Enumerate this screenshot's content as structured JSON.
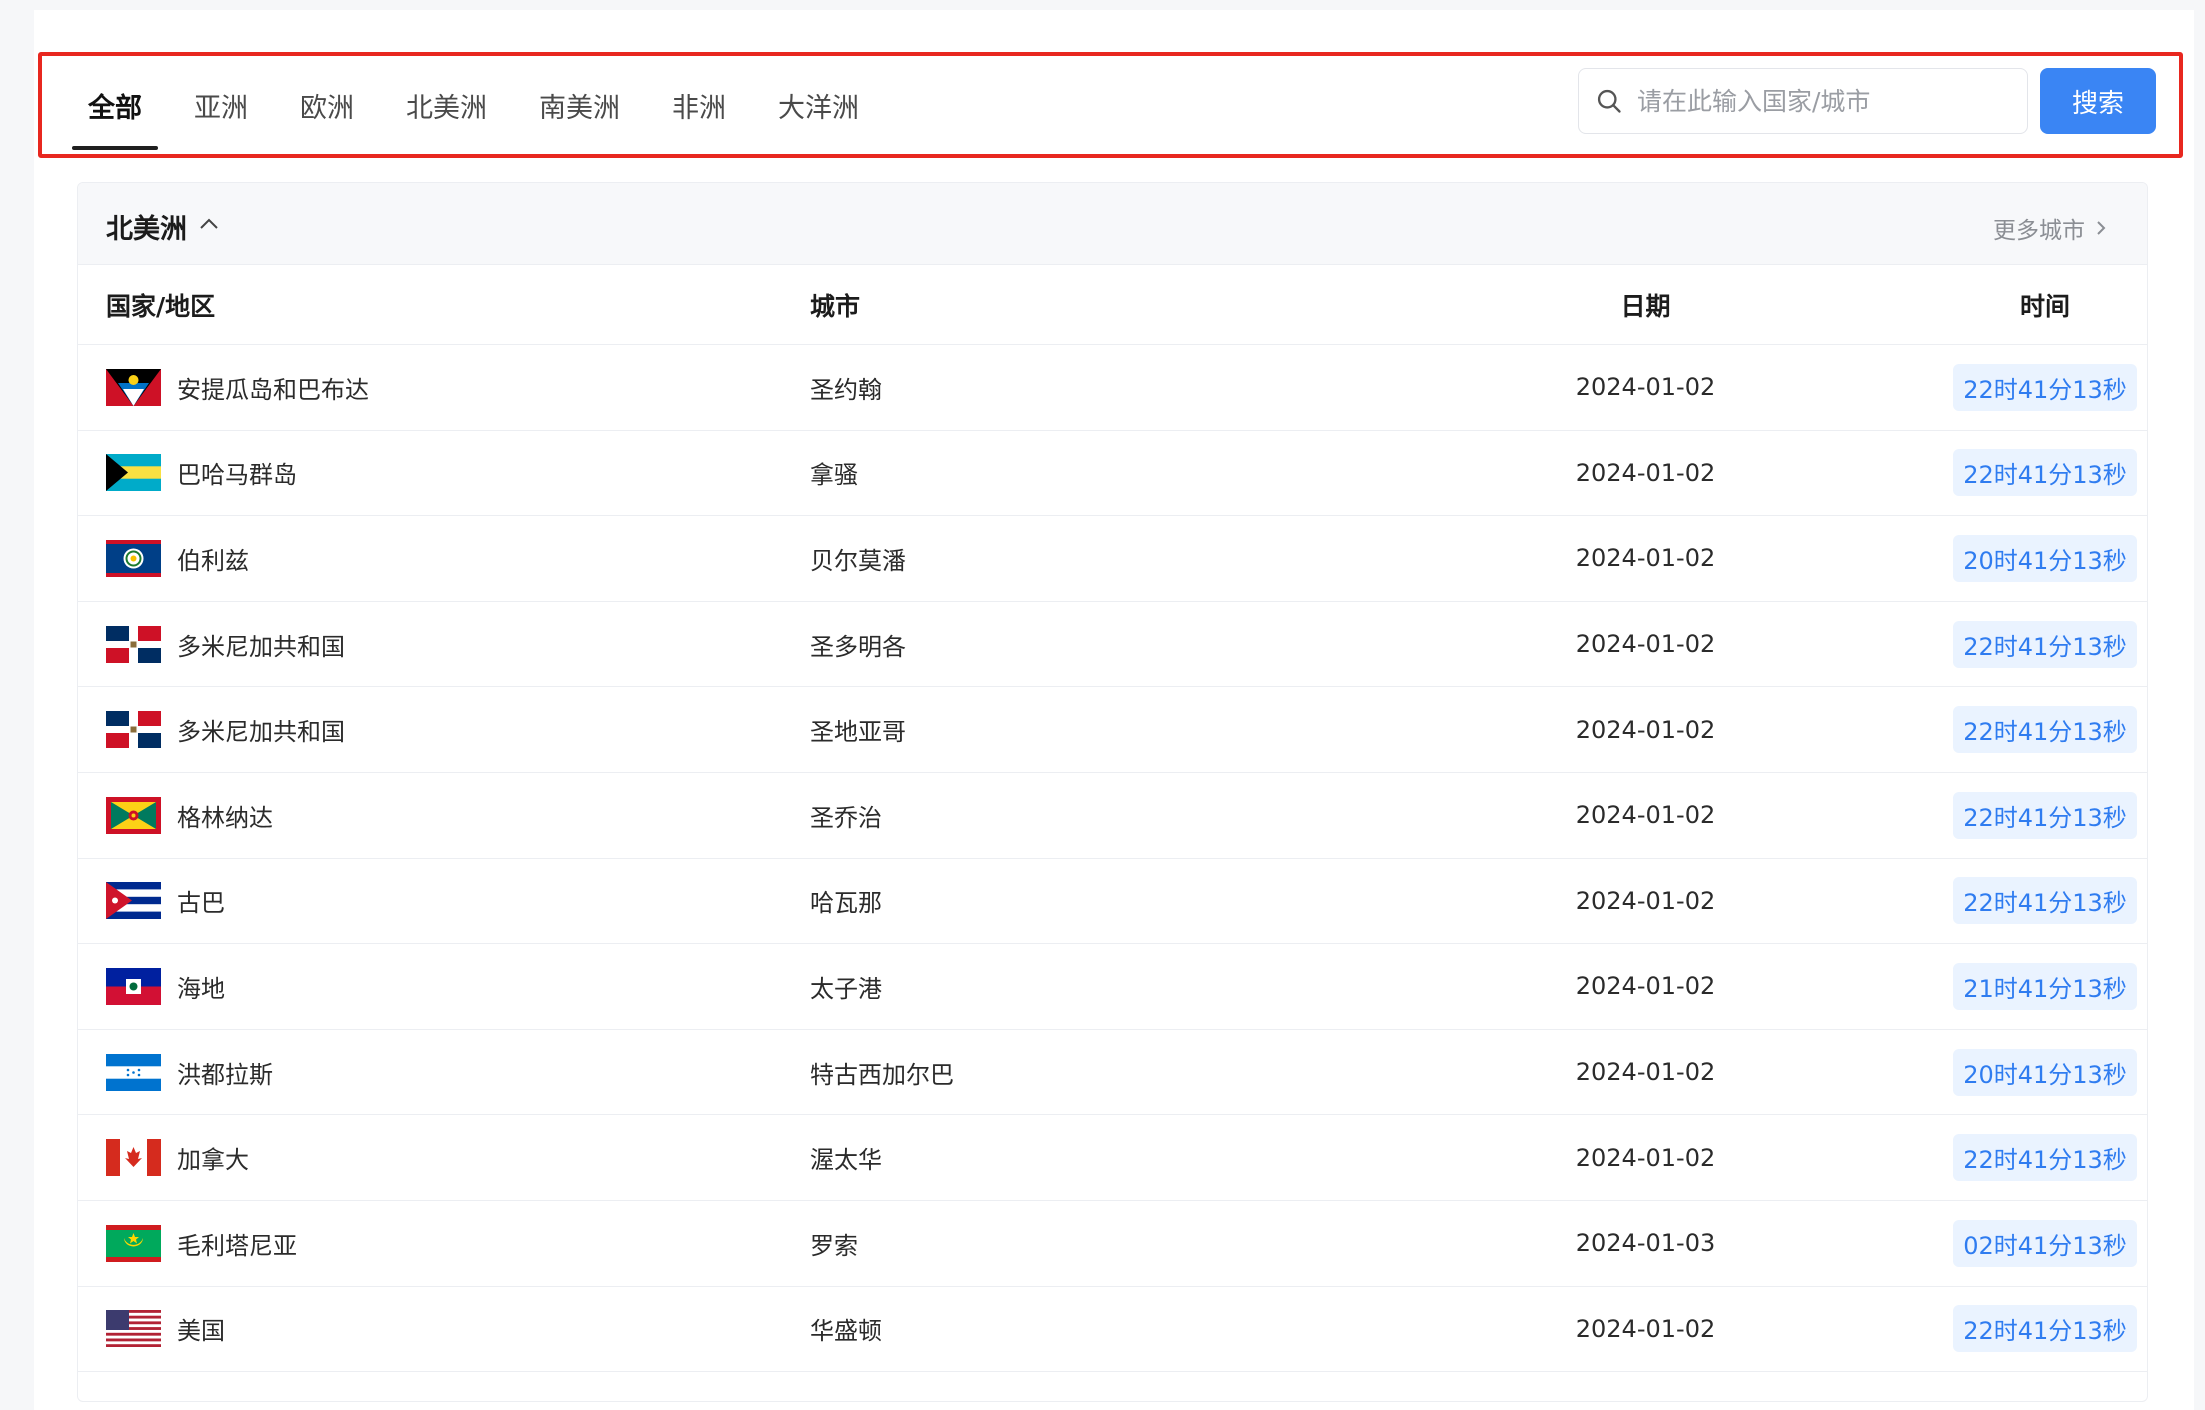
{
  "tabs": [
    {
      "label": "全部",
      "active": true
    },
    {
      "label": "亚洲",
      "active": false
    },
    {
      "label": "欧洲",
      "active": false
    },
    {
      "label": "北美洲",
      "active": false
    },
    {
      "label": "南美洲",
      "active": false
    },
    {
      "label": "非洲",
      "active": false
    },
    {
      "label": "大洋洲",
      "active": false
    }
  ],
  "search": {
    "placeholder": "请在此输入国家/城市",
    "value": "",
    "button_label": "搜索"
  },
  "region": {
    "title": "北美洲",
    "more_label": "更多城市"
  },
  "table": {
    "headers": {
      "country": "国家/地区",
      "city": "城市",
      "date": "日期",
      "time": "时间"
    },
    "rows": [
      {
        "country": "安提瓜岛和巴布达",
        "city": "圣约翰",
        "date": "2024-01-02",
        "time": "22时41分13秒",
        "flag": "antigua"
      },
      {
        "country": "巴哈马群岛",
        "city": "拿骚",
        "date": "2024-01-02",
        "time": "22时41分13秒",
        "flag": "bahamas"
      },
      {
        "country": "伯利兹",
        "city": "贝尔莫潘",
        "date": "2024-01-02",
        "time": "20时41分13秒",
        "flag": "belize"
      },
      {
        "country": "多米尼加共和国",
        "city": "圣多明各",
        "date": "2024-01-02",
        "time": "22时41分13秒",
        "flag": "dominican"
      },
      {
        "country": "多米尼加共和国",
        "city": "圣地亚哥",
        "date": "2024-01-02",
        "time": "22时41分13秒",
        "flag": "dominican"
      },
      {
        "country": "格林纳达",
        "city": "圣乔治",
        "date": "2024-01-02",
        "time": "22时41分13秒",
        "flag": "grenada"
      },
      {
        "country": "古巴",
        "city": "哈瓦那",
        "date": "2024-01-02",
        "time": "22时41分13秒",
        "flag": "cuba"
      },
      {
        "country": "海地",
        "city": "太子港",
        "date": "2024-01-02",
        "time": "21时41分13秒",
        "flag": "haiti"
      },
      {
        "country": "洪都拉斯",
        "city": "特古西加尔巴",
        "date": "2024-01-02",
        "time": "20时41分13秒",
        "flag": "honduras"
      },
      {
        "country": "加拿大",
        "city": "渥太华",
        "date": "2024-01-02",
        "time": "22时41分13秒",
        "flag": "canada"
      },
      {
        "country": "毛利塔尼亚",
        "city": "罗索",
        "date": "2024-01-03",
        "time": "02时41分13秒",
        "flag": "mauritania"
      },
      {
        "country": "美国",
        "city": "华盛顿",
        "date": "2024-01-02",
        "time": "22时41分13秒",
        "flag": "usa"
      }
    ]
  }
}
